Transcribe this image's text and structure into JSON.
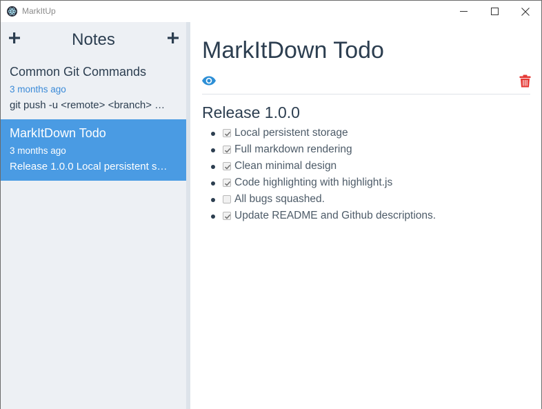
{
  "window": {
    "title": "MarkItUp"
  },
  "sidebar": {
    "title": "Notes",
    "notes": [
      {
        "title": "Common Git Commands",
        "date": "3 months ago",
        "excerpt": "git push -u <remote> <branch> …",
        "selected": false
      },
      {
        "title": "MarkItDown Todo",
        "date": "3 months ago",
        "excerpt": "Release 1.0.0 Local persistent s…",
        "selected": true
      }
    ]
  },
  "editor": {
    "title": "MarkItDown Todo",
    "heading": "Release 1.0.0",
    "todos": [
      {
        "text": "Local persistent storage",
        "checked": true
      },
      {
        "text": "Full markdown rendering",
        "checked": true
      },
      {
        "text": "Clean minimal design",
        "checked": true
      },
      {
        "text": "Code highlighting with highlight.js",
        "checked": true
      },
      {
        "text": "All bugs squashed.",
        "checked": false
      },
      {
        "text": "Update README and Github descriptions.",
        "checked": true
      }
    ]
  },
  "colors": {
    "accent": "#4a9be3",
    "text": "#2c3e50",
    "date": "#3a8ad8",
    "delete": "#e53935",
    "sidebar_bg": "#edf0f4"
  },
  "icons": {
    "app": "electron-icon",
    "add_left": "plus-icon",
    "add_right": "plus-icon",
    "preview": "eye-icon",
    "delete": "trash-icon",
    "minimize": "minimize-icon",
    "maximize": "maximize-icon",
    "close": "close-icon"
  }
}
